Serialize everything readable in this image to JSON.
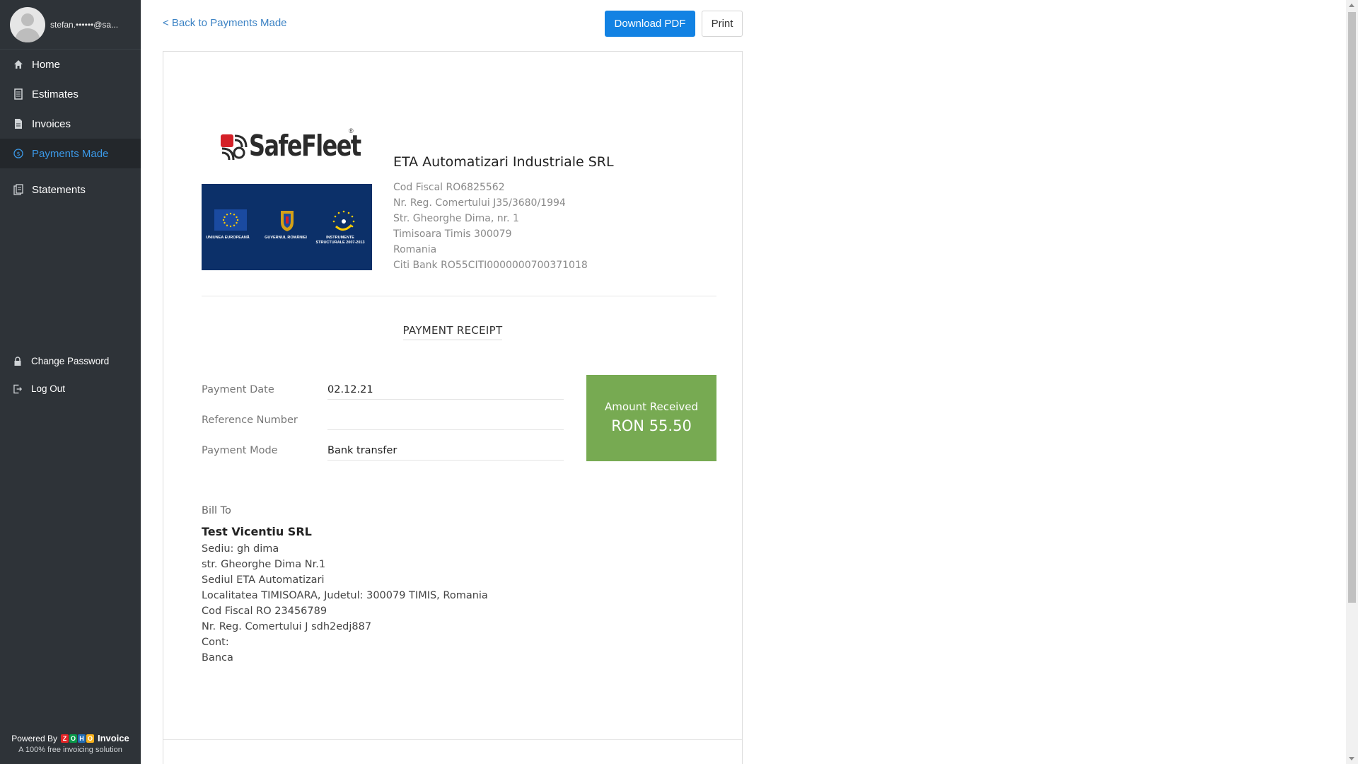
{
  "user": {
    "email": "stefan.••••••@sa..."
  },
  "sidebar": {
    "items": [
      {
        "label": "Home",
        "icon": "home-icon"
      },
      {
        "label": "Estimates",
        "icon": "estimates-icon"
      },
      {
        "label": "Invoices",
        "icon": "invoices-icon"
      },
      {
        "label": "Payments Made",
        "icon": "payments-icon",
        "active": true
      },
      {
        "label": "Statements",
        "icon": "statements-icon"
      }
    ],
    "bottom": [
      {
        "label": "Change Password",
        "icon": "lock-icon"
      },
      {
        "label": "Log Out",
        "icon": "logout-icon"
      }
    ],
    "powered_by": "Powered By",
    "powered_brand": "Invoice",
    "powered_logo": "ZOHO",
    "powered_sub": "A 100% free invoicing solution"
  },
  "toolbar": {
    "back": "< Back to Payments Made",
    "download_pdf": "Download PDF",
    "print": "Print"
  },
  "company": {
    "logo_text": "SafeFleet",
    "logo_reg": "®",
    "eu_labels": [
      "UNIUNEA EUROPEANĂ",
      "GUVERNUL ROMÂNIEI",
      "INSTRUMENTE STRUCTURALE 2007-2013"
    ],
    "name": "ETA Automatizari Industriale SRL",
    "lines": [
      "Cod Fiscal RO6825562",
      "Nr. Reg. Comertului J35/3680/1994",
      "Str. Gheorghe Dima, nr. 1",
      "Timisoara Timis 300079",
      "Romania",
      "Citi Bank RO55CITI0000000700371018"
    ]
  },
  "receipt": {
    "title": "PAYMENT RECEIPT",
    "fields": [
      {
        "label": "Payment Date",
        "value": "02.12.21"
      },
      {
        "label": "Reference Number",
        "value": ""
      },
      {
        "label": "Payment Mode",
        "value": "Bank transfer"
      }
    ],
    "amount_label": "Amount Received",
    "amount_value": "RON 55.50",
    "amount_color": "#77aa52"
  },
  "bill_to": {
    "label": "Bill To",
    "name": "Test Vicentiu SRL",
    "lines": [
      "Sediu: gh dima",
      "str. Gheorghe Dima Nr.1",
      "Sediul ETA Automatizari",
      "Localitatea TIMISOARA, Judetul: 300079 TIMIS, Romania",
      "Cod Fiscal RO 23456789",
      "Nr. Reg. Comertului J sdh2edj887",
      "Cont:",
      "Banca"
    ]
  },
  "colors": {
    "sidebar_bg": "#2e3338",
    "accent": "#1282e3",
    "active_link": "#3b98e6"
  }
}
